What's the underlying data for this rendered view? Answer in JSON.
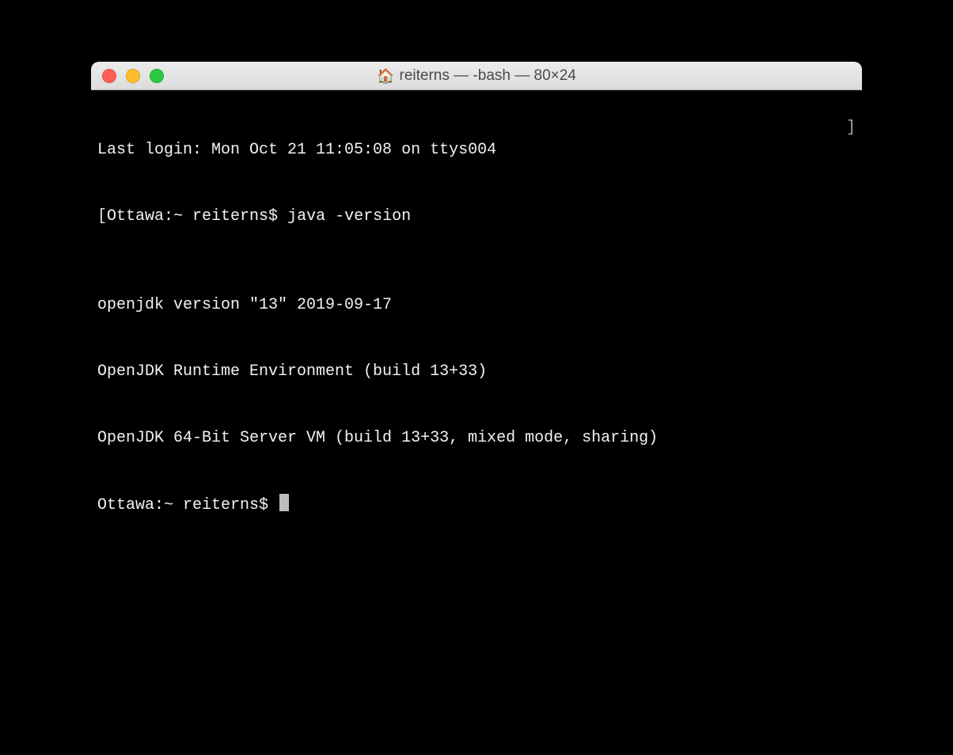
{
  "window": {
    "title": "reiterns — -bash — 80×24"
  },
  "terminal": {
    "last_login": "Last login: Mon Oct 21 11:05:08 on ttys004",
    "prompt1_prefix": "[",
    "prompt1": "Ottawa:~ reiterns$ ",
    "command1": "java -version",
    "right_bracket": "]",
    "out1": "openjdk version \"13\" 2019-09-17",
    "out2": "OpenJDK Runtime Environment (build 13+33)",
    "out3": "OpenJDK 64-Bit Server VM (build 13+33, mixed mode, sharing)",
    "prompt2": "Ottawa:~ reiterns$ "
  }
}
